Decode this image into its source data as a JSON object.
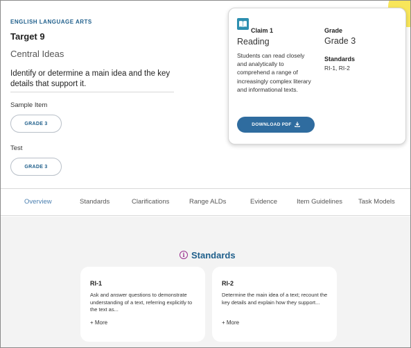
{
  "target": {
    "subject": "ENGLISH LANGUAGE ARTS",
    "title": "Target 9",
    "subtitle": "Central Ideas",
    "description": "Identify or determine a main idea and the key details that support it.",
    "sample_item_label": "Sample Item",
    "sample_item_button": "GRADE 3",
    "test_label": "Test",
    "test_button": "GRADE 3"
  },
  "claim_card": {
    "icon": "book-icon",
    "claim_label": "Claim 1",
    "claim_name": "Reading",
    "claim_description": "Students can read closely and analytically to comprehend a range of increasingly complex literary and informational texts.",
    "download_label": "DOWNLOAD PDF",
    "grade_heading": "Grade",
    "grade_value": "Grade 3",
    "standards_heading": "Standards",
    "standards_value": "RI-1, RI-2"
  },
  "tabs": [
    {
      "label": "Overview",
      "active": true
    },
    {
      "label": "Standards",
      "active": false
    },
    {
      "label": "Clarifications",
      "active": false
    },
    {
      "label": "Range ALDs",
      "active": false
    },
    {
      "label": "Evidence",
      "active": false
    },
    {
      "label": "Item Guidelines",
      "active": false
    },
    {
      "label": "Task Models",
      "active": false
    }
  ],
  "standards_section": {
    "heading": "Standards",
    "icon": "info-icon",
    "cards": [
      {
        "code": "RI-1",
        "text": "Ask and answer questions to demonstrate understanding of a text, referring explicitly to the text as...",
        "more_label": "+ More"
      },
      {
        "code": "RI-2",
        "text": "Determine the main idea of a text; recount the key details and explain how they support...",
        "more_label": "+ More"
      }
    ]
  },
  "colors": {
    "brand_blue": "#1f5f8b",
    "button_blue": "#2f6c9f",
    "active_tab": "#4a7fb0",
    "accent_purple": "#9a2f8e",
    "icon_teal": "#2d8fb0",
    "highlight_yellow": "#f8e65a"
  }
}
